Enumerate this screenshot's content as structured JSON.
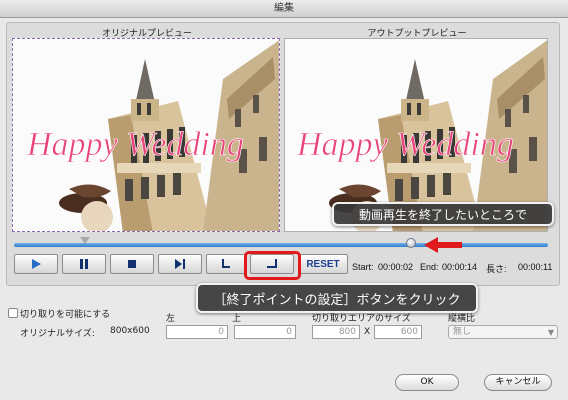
{
  "window": {
    "title": "編集"
  },
  "preview": {
    "original_label": "オリジナルプレビュー",
    "output_label": "アウトプットプレビュー",
    "overlay_text": "Happy Wedding"
  },
  "controls": {
    "reset_label": "RESET",
    "start_label": "Start:",
    "start_value": "00:00:02",
    "end_label": "End:",
    "end_value": "00:00:14",
    "length_label": "長さ:",
    "length_value": "00:00:11"
  },
  "annotations": {
    "callout_top": "動画再生を終了したいところで",
    "callout_bottom": "［終了ポイントの設定］ボタンをクリック"
  },
  "crop": {
    "enable_label": "切り取りを可能にする",
    "enabled": false,
    "original_size_label": "オリジナルサイズ:",
    "original_size_value": "800x600",
    "left_label": "左",
    "top_label": "上",
    "crop_area_label": "切り取りエリアのサイズ",
    "ratio_label": "縦横比",
    "left_value": "0",
    "top_value": "0",
    "width_value": "800",
    "times": "X",
    "height_value": "600",
    "ratio_value": "無し"
  },
  "footer": {
    "ok_label": "OK",
    "cancel_label": "キャンセル"
  },
  "colors": {
    "timeline": "#2f7fca",
    "highlight": "#e01a1a",
    "overlay_text": "#e8447a"
  },
  "icons": [
    "play-icon",
    "pause-icon",
    "stop-icon",
    "next-frame-icon",
    "set-start-icon",
    "set-end-icon"
  ]
}
